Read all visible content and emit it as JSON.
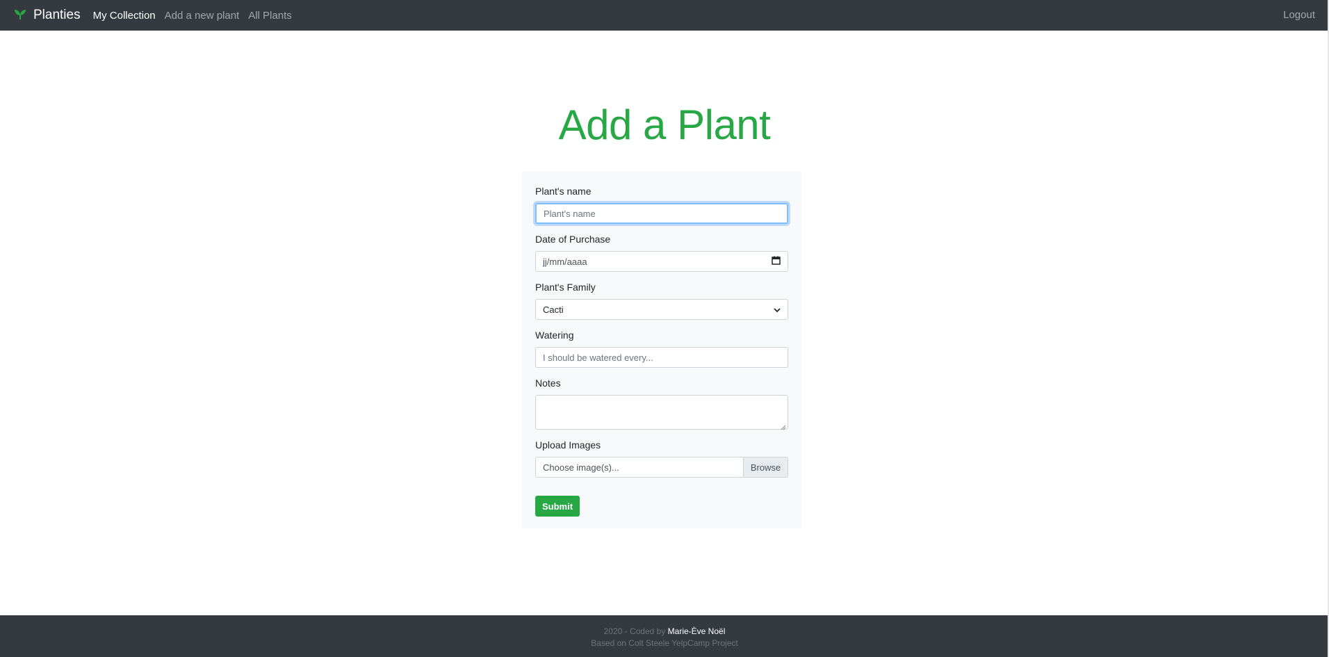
{
  "navbar": {
    "brand_name": "Planties",
    "logo_icon": "sprout-icon",
    "links": [
      {
        "label": "My Collection",
        "active": true
      },
      {
        "label": "Add a new plant",
        "active": false
      },
      {
        "label": "All Plants",
        "active": false
      }
    ],
    "logout_label": "Logout"
  },
  "page": {
    "title": "Add a Plant"
  },
  "form": {
    "name": {
      "label": "Plant's name",
      "placeholder": "Plant's name"
    },
    "purchase_date": {
      "label": "Date of Purchase",
      "placeholder": "jj/mm/aaaa"
    },
    "family": {
      "label": "Plant's Family",
      "selected": "Cacti"
    },
    "watering": {
      "label": "Watering",
      "placeholder": "I should be watered every..."
    },
    "notes": {
      "label": "Notes",
      "value": ""
    },
    "upload": {
      "label": "Upload Images",
      "placeholder": "Choose image(s)...",
      "browse_label": "Browse"
    },
    "submit_label": "Submit"
  },
  "footer": {
    "prefix": "2020 - Coded by ",
    "author": "Marie-Ève Noël",
    "credit": "Based on Colt Steele YelpCamp Project"
  },
  "colors": {
    "accent": "#28a745",
    "navbar": "#343a40",
    "card": "#f8f9fa"
  }
}
